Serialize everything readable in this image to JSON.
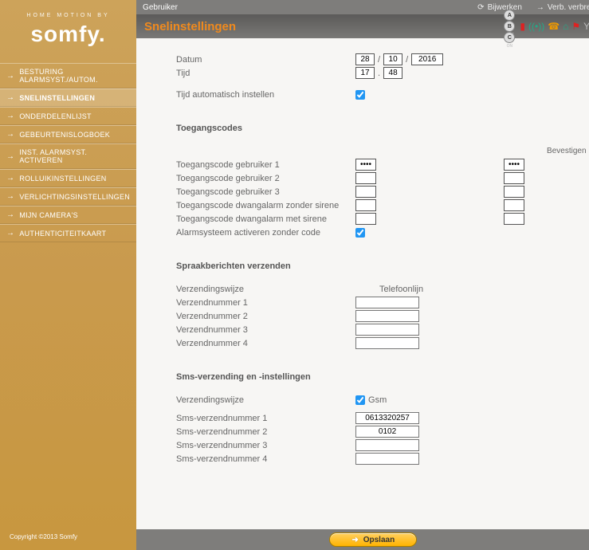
{
  "brand": {
    "top": "HOME MOTION BY",
    "main": "somfy."
  },
  "topbar": {
    "user": "Gebruiker",
    "refresh": "Bijwerken",
    "disconnect": "Verb. verbreken"
  },
  "pageTitle": "Snelinstellingen",
  "nav": {
    "items": [
      {
        "label": "BESTURING ALARMSYST./AUTOM."
      },
      {
        "label": "SNELINSTELLINGEN",
        "active": true
      },
      {
        "label": "ONDERDELENLIJST"
      },
      {
        "label": "GEBEURTENISLOGBOEK"
      },
      {
        "label": "INST. ALARMSYST. ACTIVEREN"
      },
      {
        "label": "ROLLUIKINSTELLINGEN"
      },
      {
        "label": "VERLICHTINGSINSTELLINGEN"
      },
      {
        "label": "MIJN CAMERA'S"
      },
      {
        "label": "AUTHENTICITEITKAART"
      }
    ]
  },
  "status": {
    "zones": [
      {
        "letter": "A",
        "state": "ON"
      },
      {
        "letter": "B",
        "state": "OFF"
      },
      {
        "letter": "C",
        "state": "ON"
      }
    ]
  },
  "dateSection": {
    "dateLabel": "Datum",
    "timeLabel": "Tijd",
    "autoLabel": "Tijd automatisch instellen",
    "day": "28",
    "month": "10",
    "year": "2016",
    "hour": "17",
    "minute": "48",
    "auto": true
  },
  "accessCodes": {
    "heading": "Toegangscodes",
    "confirmHeading": "Bevestigen",
    "rows": [
      {
        "label": "Toegangscode gebruiker 1",
        "value": "••••",
        "confirm": "••••"
      },
      {
        "label": "Toegangscode gebruiker 2",
        "value": "",
        "confirm": ""
      },
      {
        "label": "Toegangscode gebruiker 3",
        "value": "",
        "confirm": ""
      },
      {
        "label": "Toegangscode dwangalarm zonder sirene",
        "value": "",
        "confirm": ""
      },
      {
        "label": "Toegangscode dwangalarm met sirene",
        "value": "",
        "confirm": ""
      }
    ],
    "noCodeLabel": "Alarmsysteem activeren zonder code",
    "noCodeChecked": true
  },
  "voice": {
    "heading": "Spraakberichten verzenden",
    "methodLabel": "Verzendingswijze",
    "methodValue": "Telefoonlijn",
    "rows": [
      {
        "label": "Verzendnummer 1",
        "value": ""
      },
      {
        "label": "Verzendnummer 2",
        "value": ""
      },
      {
        "label": "Verzendnummer 3",
        "value": ""
      },
      {
        "label": "Verzendnummer 4",
        "value": ""
      }
    ]
  },
  "sms": {
    "heading": "Sms-verzending en -instellingen",
    "methodLabel": "Verzendingswijze",
    "methodValue": "Gsm",
    "methodChecked": true,
    "rows": [
      {
        "label": "Sms-verzendnummer 1",
        "value": "0613320257"
      },
      {
        "label": "Sms-verzendnummer 2",
        "value": "0102"
      },
      {
        "label": "Sms-verzendnummer 3",
        "value": ""
      },
      {
        "label": "Sms-verzendnummer 4",
        "value": ""
      }
    ]
  },
  "saveLabel": "Opslaan",
  "copyright": "Copyright ©2013 Somfy"
}
